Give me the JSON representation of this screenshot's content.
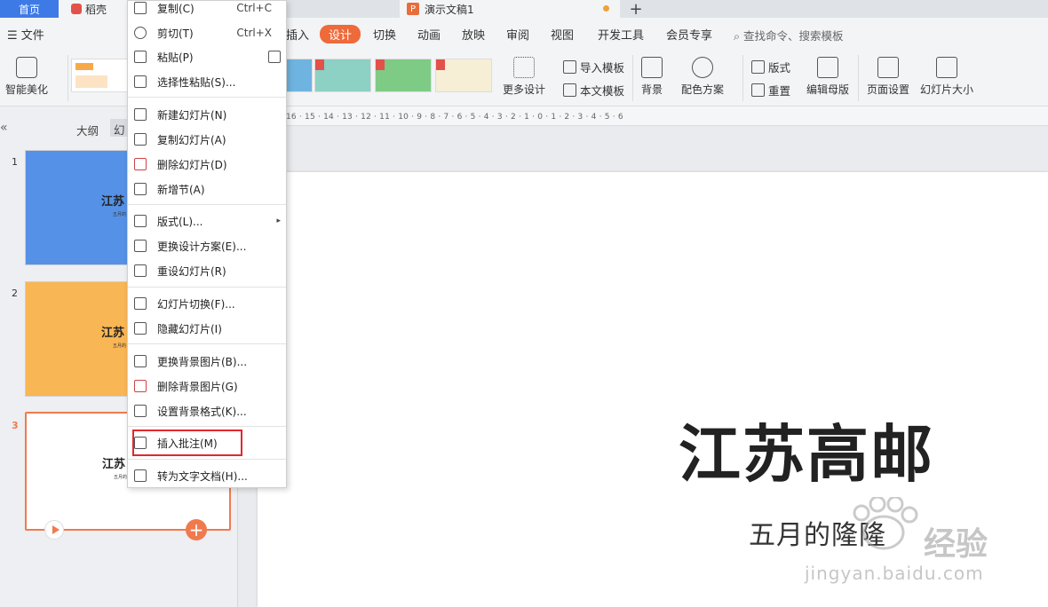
{
  "tabs": {
    "home": "首页",
    "daoke": "稻壳",
    "document": "演示文稿1",
    "add": "+"
  },
  "menubar": {
    "file": "文件",
    "items": [
      "插入",
      "设计",
      "切换",
      "动画",
      "放映",
      "审阅",
      "视图",
      "开发工具",
      "会员专享"
    ],
    "active": "设计",
    "search": "查找命令、搜索模板"
  },
  "ribbon": {
    "smart_beautify": "智能美化",
    "more_design": "更多设计",
    "import_template": "导入模板",
    "text_template": "本文模板",
    "background": "背景",
    "color_scheme": "配色方案",
    "layout": "版式",
    "reset": "重置",
    "edit_master": "编辑母版",
    "page_setup": "页面设置",
    "slide_size": "幻灯片大小"
  },
  "left_panel": {
    "collapse": "«",
    "outline": "大纲",
    "slides_tab": "幻",
    "slides": [
      {
        "num": "1",
        "title": "江苏",
        "sub": "五月的",
        "color": "#5591e6"
      },
      {
        "num": "2",
        "title": "江苏",
        "sub": "五月的",
        "color": "#f9b654"
      },
      {
        "num": "3",
        "title": "江苏",
        "sub": "五月的",
        "color": "#ffffff"
      }
    ]
  },
  "ruler_text": "16 · 15 · 14 · 13 · 12 · 11 · 10 · 9 · 8 · 7 · 6 · 5 · 4 · 3 · 2 · 1 · 0 · 1 · 2 · 3 · 4 · 5 · 6",
  "slide": {
    "title": "江苏高邮",
    "subtitle": "五月的隆隆"
  },
  "watermark": {
    "main": "经验",
    "url": "jingyan.baidu.com"
  },
  "context_menu": {
    "items": [
      {
        "label": "复制(C)",
        "shortcut": "Ctrl+C",
        "icon": "copy-icon"
      },
      {
        "label": "剪切(T)",
        "shortcut": "Ctrl+X",
        "icon": "cut-icon"
      },
      {
        "label": "粘贴(P)",
        "shortcut": "",
        "icon": "paste-icon"
      },
      {
        "label": "选择性粘贴(S)...",
        "shortcut": "",
        "icon": "paste-special-icon"
      },
      {
        "label": "新建幻灯片(N)",
        "shortcut": "",
        "icon": "new-slide-icon"
      },
      {
        "label": "复制幻灯片(A)",
        "shortcut": "",
        "icon": "duplicate-slide-icon"
      },
      {
        "label": "删除幻灯片(D)",
        "shortcut": "",
        "icon": "delete-slide-icon"
      },
      {
        "label": "新增节(A)",
        "shortcut": "",
        "icon": "add-section-icon"
      },
      {
        "label": "版式(L)...",
        "shortcut": "▸",
        "icon": "layout-icon"
      },
      {
        "label": "更换设计方案(E)...",
        "shortcut": "",
        "icon": "change-design-icon"
      },
      {
        "label": "重设幻灯片(R)",
        "shortcut": "",
        "icon": "reset-slide-icon"
      },
      {
        "label": "幻灯片切换(F)...",
        "shortcut": "",
        "icon": "transition-icon"
      },
      {
        "label": "隐藏幻灯片(I)",
        "shortcut": "",
        "icon": "hide-slide-icon"
      },
      {
        "label": "更换背景图片(B)...",
        "shortcut": "",
        "icon": "change-bg-icon"
      },
      {
        "label": "删除背景图片(G)",
        "shortcut": "",
        "icon": "delete-bg-icon"
      },
      {
        "label": "设置背景格式(K)...",
        "shortcut": "",
        "icon": "bg-format-icon"
      },
      {
        "label": "插入批注(M)",
        "shortcut": "",
        "icon": "insert-comment-icon"
      },
      {
        "label": "转为文字文档(H)...",
        "shortcut": "",
        "icon": "convert-doc-icon"
      }
    ]
  },
  "colors": {
    "accent": "#ee6a3a",
    "home_tab": "#3e7ae6",
    "highlight": "#e0282e"
  }
}
